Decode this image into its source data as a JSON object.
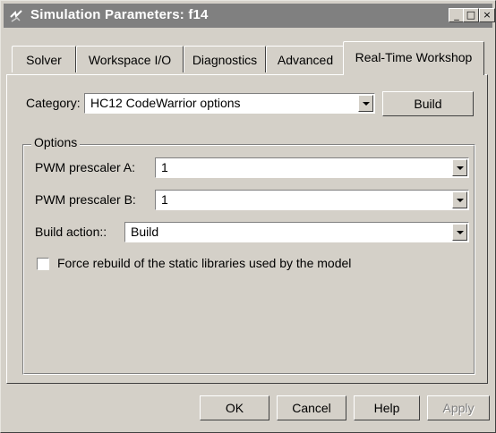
{
  "window": {
    "title": "Simulation Parameters: f14",
    "minimize_glyph": "_",
    "maximize_glyph": "□",
    "close_glyph": "×"
  },
  "tabs": [
    {
      "label": "Solver"
    },
    {
      "label": "Workspace I/O"
    },
    {
      "label": "Diagnostics"
    },
    {
      "label": "Advanced"
    },
    {
      "label": "Real-Time Workshop",
      "active": true
    }
  ],
  "category": {
    "label": "Category:",
    "value": "HC12 CodeWarrior options",
    "build_button": "Build"
  },
  "options": {
    "group_title": "Options",
    "pwm_a": {
      "label": "PWM prescaler A:",
      "value": "1"
    },
    "pwm_b": {
      "label": "PWM prescaler B:",
      "value": "1"
    },
    "build_action": {
      "label": "Build action::",
      "value": "Build"
    },
    "force_rebuild": {
      "label": "Force rebuild of the static libraries used by the model",
      "checked": false
    }
  },
  "footer": {
    "ok": "OK",
    "cancel": "Cancel",
    "help": "Help",
    "apply": "Apply"
  },
  "colors": {
    "titlebar_inactive": "#808080",
    "face": "#d4d0c8"
  },
  "icons": {
    "app": "simulink-icon"
  }
}
